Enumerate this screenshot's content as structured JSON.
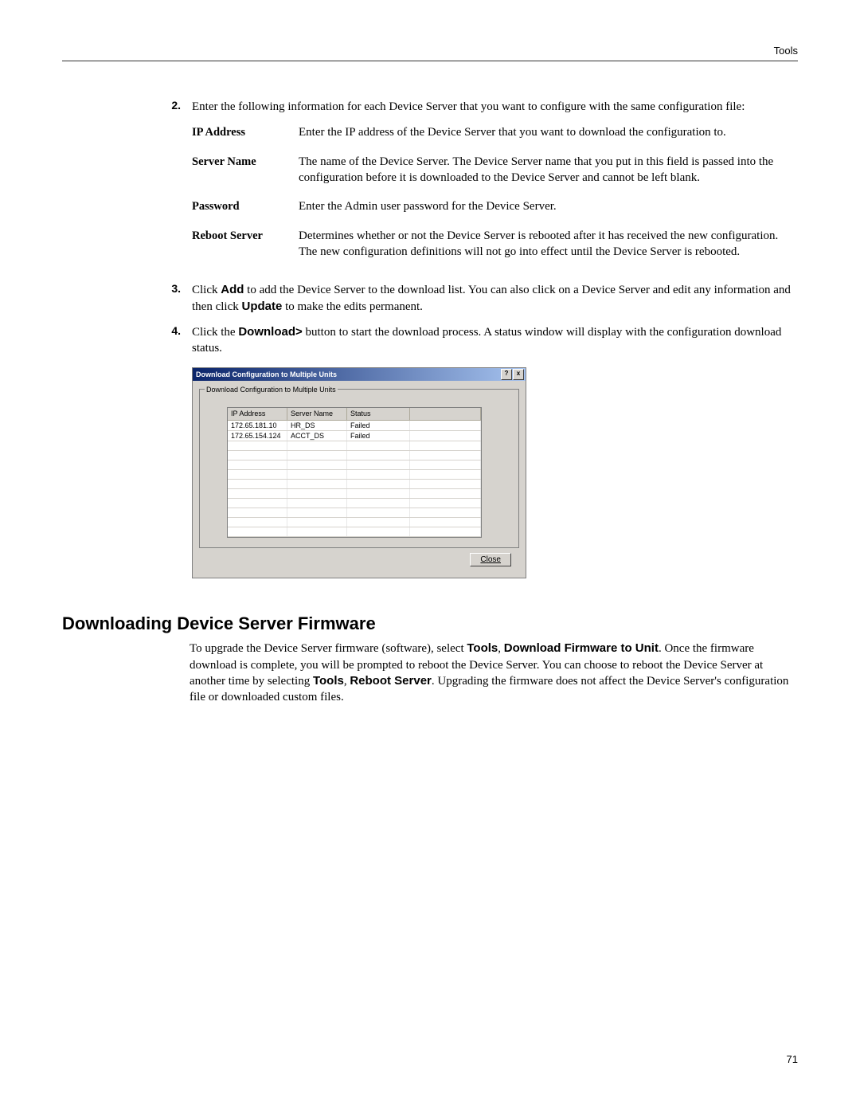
{
  "header": {
    "section": "Tools"
  },
  "steps": {
    "s2": {
      "num": "2.",
      "intro": "Enter the following information for each Device Server that you want to configure with the same configuration file:",
      "rows": [
        {
          "term": "IP Address",
          "desc": "Enter the IP address of the Device Server that you want to download the configuration to."
        },
        {
          "term": "Server Name",
          "desc": "The name of the Device Server. The Device Server name that you put in this field is passed into the configuration before it is downloaded to the Device Server and cannot be left blank."
        },
        {
          "term": "Password",
          "desc": "Enter the Admin user password for the Device Server."
        },
        {
          "term": "Reboot Server",
          "desc": "Determines whether or not the Device Server is rebooted after it has received the new configuration. The new configuration definitions will not go into effect until the Device Server is rebooted."
        }
      ]
    },
    "s3": {
      "num": "3.",
      "pre": "Click ",
      "b1": "Add",
      "mid": " to add the Device Server to the download list. You can also click on a Device Server and edit any information and then click ",
      "b2": "Update",
      "post": " to make the edits permanent."
    },
    "s4": {
      "num": "4.",
      "pre": "Click the ",
      "b1": "Download>",
      "post": " button to start the download process. A status window will display with the configuration download status."
    }
  },
  "dialog": {
    "title": "Download Configuration to Multiple Units",
    "legend": "Download Configuration to Multiple Units",
    "help": "?",
    "close_x": "x",
    "headers": {
      "c1": "IP Address",
      "c2": "Server Name",
      "c3": "Status",
      "c4": ""
    },
    "rows": [
      {
        "ip": "172.65.181.10",
        "name": "HR_DS",
        "status": "Failed"
      },
      {
        "ip": "172.65.154.124",
        "name": "ACCT_DS",
        "status": "Failed"
      }
    ],
    "close_u": "C",
    "close_rest": "lose"
  },
  "section2": {
    "title": "Downloading Device Server Firmware",
    "p_pre": "To upgrade the Device Server firmware (software), select ",
    "b1": "Tools",
    "sep": ", ",
    "b2": "Download Firmware to Unit",
    "mid": ". Once the firmware download is complete, you will be prompted to reboot the Device Server. You can choose to reboot the Device Server at another time by selecting ",
    "b3": "Tools",
    "b4": "Reboot Server",
    "post": ". Upgrading the firmware does not affect the Device Server's configuration file or downloaded custom files."
  },
  "page_number": "71"
}
